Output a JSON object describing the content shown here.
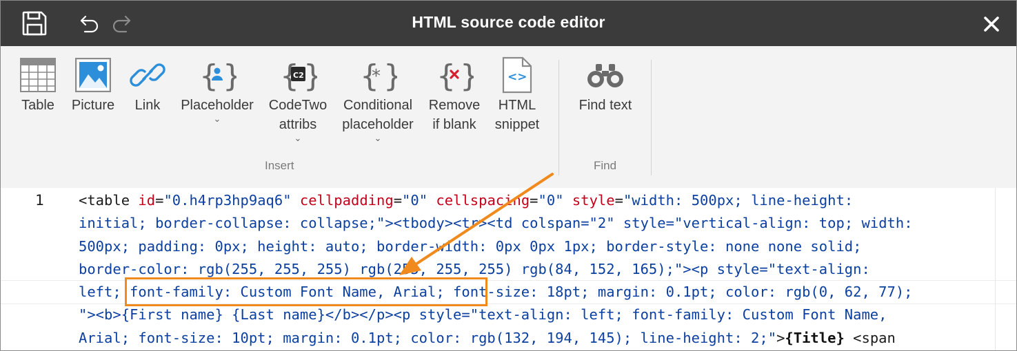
{
  "window": {
    "title": "HTML source code editor"
  },
  "icons": {
    "save": "save-icon",
    "undo": "undo-icon",
    "redo": "redo-icon",
    "close": "close-icon"
  },
  "ribbon": {
    "insert_items": [
      {
        "label": "Table"
      },
      {
        "label": "Picture"
      },
      {
        "label": "Link"
      },
      {
        "label": "Placeholder"
      },
      {
        "label1": "CodeTwo",
        "label2": "attribs"
      },
      {
        "label1": "Conditional",
        "label2": "placeholder"
      },
      {
        "label1": "Remove",
        "label2": "if blank"
      },
      {
        "label1": "HTML",
        "label2": "snippet"
      }
    ],
    "find_items": [
      {
        "label": "Find text"
      }
    ],
    "groups": {
      "insert": "Insert",
      "find": "Find"
    }
  },
  "editor": {
    "line_number": "1",
    "lines": [
      "<table id=\"0.h4rp3hp9aq6\" cellpadding=\"0\" cellspacing=\"0\" style=\"width: 500px; line-height:",
      "initial; border-collapse: collapse;\"><tbody><tr><td colspan=\"2\" style=\"vertical-align: top; width:",
      "500px; padding: 0px; height: auto; border-width: 0px 0px 1px; border-style: none none solid;",
      "border-color: rgb(255, 255, 255) rgb(255, 255, 255) rgb(84, 152, 165);\"><p style=\"text-align:",
      "left; font-family: Custom Font Name, Arial; font-size: 18pt; margin: 0.1pt; color: rgb(0, 62, 77);",
      "\"><b>{First name} {Last name}</b></p><p style=\"text-align: left; font-family: Custom Font Name,",
      "Arial; font-size: 10pt; margin: 0.1pt; color: rgb(132, 194, 145); line-height: 2;\">{Title} <span"
    ]
  },
  "annotation": {
    "color": "#f08a1c",
    "highlighted_text": "font-family: Custom Font Name, Arial;"
  }
}
